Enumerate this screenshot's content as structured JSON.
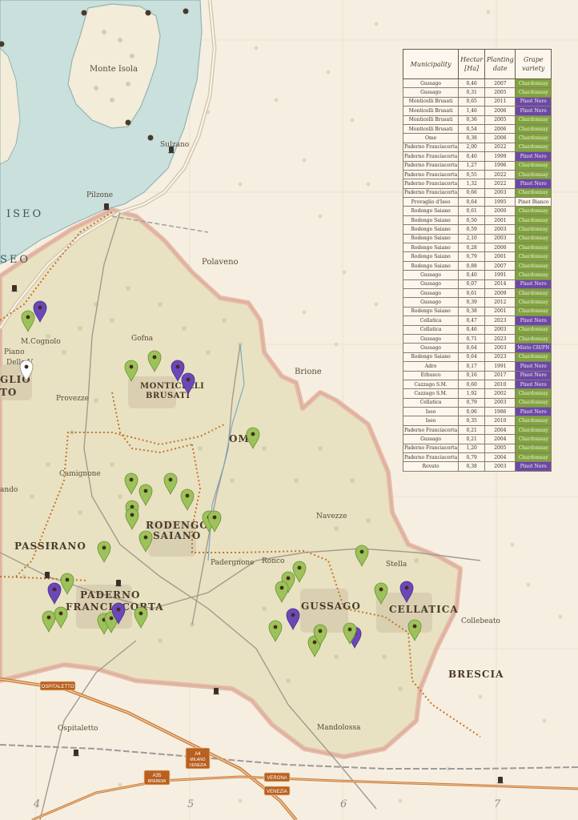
{
  "colors": {
    "paper": "#f6efe1",
    "lake": "#c9e0dd",
    "region_fill": "#e6dfbf",
    "region_border": "#e3b8a6",
    "road": "#c87a3a",
    "railway": "#8a8a8a",
    "dotted_border": "#c4742c",
    "chardonnay_pin": "#9cc25a",
    "pinot_nero_pin": "#6b48b8",
    "pinot_bianco_pin": "#ffffff"
  },
  "map": {
    "lake_label": "ISEO",
    "lake_label_2": "SEO",
    "island_label": "Monte Isola",
    "places": [
      {
        "id": "sulzano",
        "name": "Sulzano"
      },
      {
        "id": "pilzone",
        "name": "Pilzone"
      },
      {
        "id": "polaveno",
        "name": "Polaveno"
      },
      {
        "id": "brione",
        "name": "Brione"
      },
      {
        "id": "mcognolo",
        "name": "M.Cognolo"
      },
      {
        "id": "piano",
        "name": "Piano"
      },
      {
        "id": "delle",
        "name": "Delle V"
      },
      {
        "id": "glio",
        "name": "GLIO"
      },
      {
        "id": "to",
        "name": "TO"
      },
      {
        "id": "provezze",
        "name": "Provezze"
      },
      {
        "id": "gofna",
        "name": "Gofna"
      },
      {
        "id": "monticelli",
        "name": "MONTICELLI"
      },
      {
        "id": "brusati",
        "name": "BRUSATI"
      },
      {
        "id": "ome",
        "name": "OME"
      },
      {
        "id": "camignone",
        "name": "Camignone"
      },
      {
        "id": "ando",
        "name": "ando"
      },
      {
        "id": "rodengo",
        "name": "RODENGO"
      },
      {
        "id": "saiano",
        "name": "SAIANO"
      },
      {
        "id": "navezze",
        "name": "Navezze"
      },
      {
        "id": "passirano",
        "name": "PASSIRANO"
      },
      {
        "id": "padergnone",
        "name": "Padergnone"
      },
      {
        "id": "ronco",
        "name": "Ronco"
      },
      {
        "id": "stella",
        "name": "Stella"
      },
      {
        "id": "paderno",
        "name": "PADERNO"
      },
      {
        "id": "franciacorta",
        "name": "FRANCIACORTA"
      },
      {
        "id": "gussago",
        "name": "GUSSAGO"
      },
      {
        "id": "cellatica",
        "name": "CELLATICA"
      },
      {
        "id": "collebeato",
        "name": "Collebeato"
      },
      {
        "id": "brescia",
        "name": "BRESCIA"
      },
      {
        "id": "ospitaletto_town",
        "name": "Ospitaletto"
      },
      {
        "id": "mandolossa",
        "name": "Mandolossa"
      }
    ],
    "road_signs": {
      "ospitaletto": "OSPITALETTO",
      "a4_line1": "A4",
      "a4_line2": "MILANO",
      "a4_line3": "VENEZIA",
      "a35_line1": "A35",
      "a35_line2": "BREBEMI",
      "verona": "VERONA",
      "venezia": "VENEZIA"
    },
    "grid_numbers": [
      "4",
      "5",
      "6",
      "7"
    ],
    "pins": [
      {
        "variety": "Chardonnay"
      },
      {
        "variety": "Pinot Nero"
      },
      {
        "variety": "Pinot Bianco"
      },
      {
        "variety": "Chardonnay"
      },
      {
        "variety": "Chardonnay"
      },
      {
        "variety": "Pinot Nero"
      },
      {
        "variety": "Pinot Nero"
      },
      {
        "variety": "Chardonnay"
      },
      {
        "variety": "Chardonnay"
      },
      {
        "variety": "Chardonnay"
      },
      {
        "variety": "Chardonnay"
      },
      {
        "variety": "Chardonnay"
      },
      {
        "variety": "Chardonnay"
      },
      {
        "variety": "Chardonnay"
      },
      {
        "variety": "Chardonnay"
      },
      {
        "variety": "Chardonnay"
      },
      {
        "variety": "Chardonnay"
      },
      {
        "variety": "Chardonnay"
      },
      {
        "variety": "Chardonnay"
      },
      {
        "variety": "Pinot Nero"
      },
      {
        "variety": "Chardonnay"
      },
      {
        "variety": "Chardonnay"
      },
      {
        "variety": "Chardonnay"
      },
      {
        "variety": "Chardonnay"
      },
      {
        "variety": "Pinot Nero"
      },
      {
        "variety": "Chardonnay"
      },
      {
        "variety": "Chardonnay"
      },
      {
        "variety": "Chardonnay"
      },
      {
        "variety": "Chardonnay"
      },
      {
        "variety": "Pinot Nero"
      },
      {
        "variety": "Chardonnay"
      },
      {
        "variety": "Chardonnay"
      },
      {
        "variety": "Chardonnay"
      },
      {
        "variety": "Chardonnay"
      },
      {
        "variety": "Pinot Nero"
      },
      {
        "variety": "Chardonnay"
      },
      {
        "variety": "Pinot Nero"
      },
      {
        "variety": "Chardonnay"
      },
      {
        "variety": "Chardonnay"
      }
    ]
  },
  "table": {
    "headers": [
      "Municipality",
      "Hectar [Ha]",
      "Planting date",
      "Grape variety"
    ],
    "rows": [
      [
        "Gussago",
        "0,46",
        "2007",
        "Chardonnay"
      ],
      [
        "Gussago",
        "0,31",
        "2005",
        "Chardonnay"
      ],
      [
        "Monticelli Brusati",
        "0,65",
        "2011",
        "Pinot Nero"
      ],
      [
        "Monticelli Brusati",
        "1,46",
        "2006",
        "Pinot Nero"
      ],
      [
        "Monticelli Brusati",
        "0,36",
        "2005",
        "Chardonnay"
      ],
      [
        "Monticelli Brusati",
        "0,54",
        "2006",
        "Chardonnay"
      ],
      [
        "Ome",
        "0,38",
        "2006",
        "Chardonnay"
      ],
      [
        "Paderno Franciacorta",
        "2,00",
        "2022",
        "Chardonnay"
      ],
      [
        "Paderno Franciacorta",
        "0,40",
        "1999",
        "Pinot Nero"
      ],
      [
        "Paderno Franciacorta",
        "1,27",
        "1996",
        "Chardonnay"
      ],
      [
        "Paderno Franciacorta",
        "0,55",
        "2022",
        "Chardonnay"
      ],
      [
        "Paderno Franciacorta",
        "1,32",
        "2022",
        "Pinot Nero"
      ],
      [
        "Paderno Franciacorta",
        "0,66",
        "2003",
        "Chardonnay"
      ],
      [
        "Provaglio d'Iseo",
        "0,64",
        "1995",
        "Pinot Bianco"
      ],
      [
        "Rodengo Saiano",
        "0,61",
        "2000",
        "Chardonnay"
      ],
      [
        "Rodengo Saiano",
        "0,50",
        "2001",
        "Chardonnay"
      ],
      [
        "Rodengo Saiano",
        "0,59",
        "2003",
        "Chardonnay"
      ],
      [
        "Rodengo Saiano",
        "2,10",
        "2003",
        "Chardonnay"
      ],
      [
        "Rodengo Saiano",
        "0,28",
        "2000",
        "Chardonnay"
      ],
      [
        "Rodengo Saiano",
        "0,79",
        "2001",
        "Chardonnay"
      ],
      [
        "Rodengo Saiano",
        "0,88",
        "2007",
        "Chardonnay"
      ],
      [
        "Gussago",
        "0,40",
        "1991",
        "Chardonnay"
      ],
      [
        "Gussago",
        "0,07",
        "2014",
        "Pinot Nero"
      ],
      [
        "Gussago",
        "0,61",
        "2009",
        "Chardonnay"
      ],
      [
        "Gussago",
        "0,39",
        "2012",
        "Chardonnay"
      ],
      [
        "Rodengo Saiano",
        "0,38",
        "2001",
        "Chardonnay"
      ],
      [
        "Cellatica",
        "0,47",
        "2023",
        "Pinot Nero"
      ],
      [
        "Cellatica",
        "0,46",
        "2003",
        "Chardonnay"
      ],
      [
        "Gussago",
        "0,71",
        "2023",
        "Chardonnay"
      ],
      [
        "Gussago",
        "0,64",
        "2003",
        "Misto CH/PN"
      ],
      [
        "Rodengo Saiano",
        "0,64",
        "2023",
        "Chardonnay"
      ],
      [
        "Adro",
        "0,17",
        "1991",
        "Pinot Nero"
      ],
      [
        "Erbusco",
        "0,16",
        "2017",
        "Pinot Nero"
      ],
      [
        "Cazzago S.M.",
        "0,60",
        "2010",
        "Pinot Nero"
      ],
      [
        "Cazzago S.M.",
        "1,92",
        "2002",
        "Chardonnay"
      ],
      [
        "Cellatica",
        "0,79",
        "2003",
        "Chardonnay"
      ],
      [
        "Iseo",
        "0,06",
        "1986",
        "Pinot Nero"
      ],
      [
        "Iseo",
        "0,35",
        "2010",
        "Chardonnay"
      ],
      [
        "Paderno Franciacorta",
        "0,21",
        "2004",
        "Chardonnay"
      ],
      [
        "Gussago",
        "0,21",
        "2004",
        "Chardonnay"
      ],
      [
        "Paderno Franciacorta",
        "1,20",
        "2005",
        "Chardonnay"
      ],
      [
        "Paderno Franciacorta",
        "0,79",
        "2004",
        "Chardonnay"
      ],
      [
        "Rovato",
        "0,38",
        "2003",
        "Pinot Nero"
      ]
    ]
  }
}
